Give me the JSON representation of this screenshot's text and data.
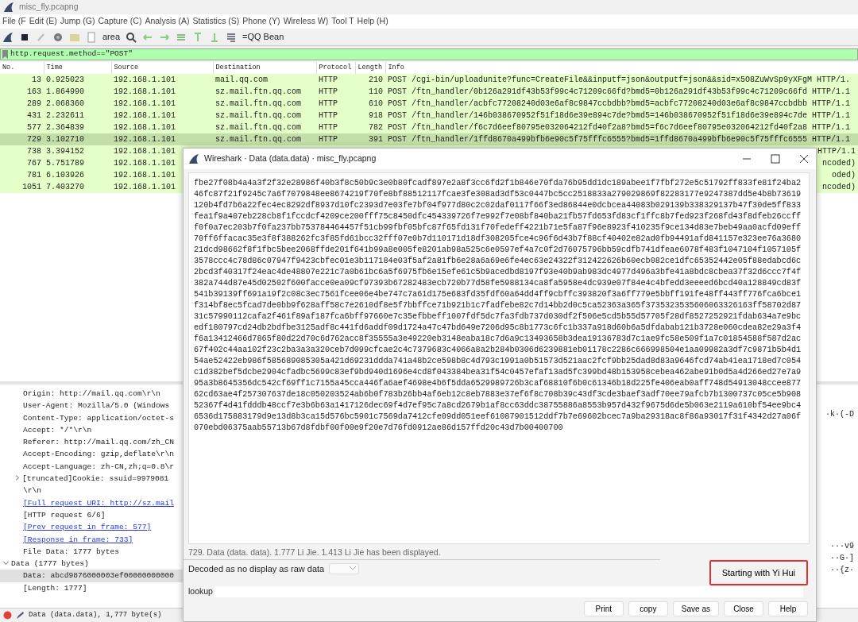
{
  "window": {
    "title": "misc_fly.pcapng"
  },
  "menu": [
    "File (F",
    "Edit (E)",
    "Jump (G)",
    "Capture (C)",
    "Analysis (A)",
    "Statistics (S)",
    "Phone (Y)",
    "Wireless W)",
    "Tool T",
    "Help (H)"
  ],
  "toolbar": {
    "labels": [
      "area",
      "=QQ Bean"
    ]
  },
  "filter": {
    "value": "http.request.method==\"POST\""
  },
  "packet_list": {
    "columns": [
      "No.",
      "Time",
      "Source",
      "Destination",
      "Protocol",
      "Length",
      "Info"
    ],
    "rows": [
      {
        "no": "13",
        "time": "0.925023",
        "source": "192.168.1.101",
        "destination": "mail.qq.com",
        "protocol": "HTTP",
        "length": "210",
        "info": "POST /cgi-bin/uploadunite?func=CreateFile&&inputf=json&outputf=json&&sid=x5O8ZuWvSp9yXFgM HTTP/1.",
        "selected": false
      },
      {
        "no": "163",
        "time": "1.864990",
        "source": "192.168.1.101",
        "destination": "sz.mail.ftn.qq.com",
        "protocol": "HTTP",
        "length": "110",
        "info": "POST /ftn_handler/0b126a291df43b53f99c4c71209c66fd?bmd5=0b126a291df43b53f99c4c71209c66fd HTTP/1.1",
        "selected": false
      },
      {
        "no": "289",
        "time": "2.068360",
        "source": "192.168.1.101",
        "destination": "sz.mail.ftn.qq.com",
        "protocol": "HTTP",
        "length": "610",
        "info": "POST /ftn_handler/acbfc77208240d03e6af8c9847ccbdbb?bmd5=acbfc77208240d03e6af8c9847ccbdbb HTTP/1.1",
        "selected": false
      },
      {
        "no": "431",
        "time": "2.232611",
        "source": "192.168.1.101",
        "destination": "sz.mail.ftn.qq.com",
        "protocol": "HTTP",
        "length": "918",
        "info": "POST /ftn_handler/146b038670952f51f18d6e39e894c7de?bmd5=146b038670952f51f18d6e39e894c7de HTTP/1.1",
        "selected": false
      },
      {
        "no": "577",
        "time": "2.364839",
        "source": "192.168.1.101",
        "destination": "sz.mail.ftn.qq.com",
        "protocol": "HTTP",
        "length": "782",
        "info": "POST /ftn_handler/f6c7d6eef80795e032064212fd40f2a8?bmd5=f6c7d6eef80795e032064212fd40f2a8 HTTP/1.1",
        "selected": false
      },
      {
        "no": "729",
        "time": "3.102710",
        "source": "192.168.1.101",
        "destination": "sz.mail.ftn.qq.com",
        "protocol": "HTTP",
        "length": "391",
        "info": "POST /ftn_handler/1ffd8670a499bfb6e90c5f75fffc6555?bmd5=1ffd8670a499bfb6e90c5f75fffc6555 HTTP/1.1",
        "selected": true
      },
      {
        "no": "738",
        "time": "3.394152",
        "source": "192.168.1.101",
        "info_tail": "HTTP/1.1",
        "selected": false
      },
      {
        "no": "767",
        "time": "5.751789",
        "source": "192.168.1.101",
        "info_tail": "ncoded)",
        "selected": false
      },
      {
        "no": "781",
        "time": "6.103926",
        "source": "192.168.1.101",
        "info_tail": "oded)",
        "selected": false
      },
      {
        "no": "1051",
        "time": "7.403270",
        "source": "192.168.1.101",
        "info_tail": "ncoded)",
        "selected": false
      }
    ]
  },
  "details": {
    "http_items": [
      {
        "text": "Origin: http://mail.qq.com\\r\\n",
        "kind": "field",
        "selected": false
      },
      {
        "text": "User-Agent: Mozilla/5.0 (Windows",
        "kind": "field",
        "selected": false
      },
      {
        "text": "Content-Type: application/octet-s",
        "kind": "field",
        "selected": false
      },
      {
        "text": "Accept: */*\\r\\n",
        "kind": "field",
        "selected": false
      },
      {
        "text": "Referer: http://mail.qq.com/zh_CN",
        "kind": "field",
        "selected": false
      },
      {
        "text": "Accept-Encoding: gzip,deflate\\r\\n",
        "kind": "field",
        "selected": false
      },
      {
        "text": "Accept-Language: zh-CN,zh;q=0.8\\r",
        "kind": "field",
        "selected": false
      },
      {
        "text": "[truncated]Cookie: ssuid=9979081",
        "kind": "field",
        "expanded": false,
        "selected": false
      },
      {
        "text": "\\r\\n",
        "kind": "field",
        "selected": false
      },
      {
        "text": "[Full request URI: http://sz.mail",
        "kind": "link",
        "selected": false
      },
      {
        "text": "[HTTP request 6/6]",
        "kind": "field",
        "selected": false
      },
      {
        "text": "[Prev request in frame: 577]",
        "kind": "link",
        "selected": false
      },
      {
        "text": "[Response in frame: 733]",
        "kind": "link",
        "selected": false
      },
      {
        "text": "File Data: 1777 bytes",
        "kind": "field",
        "selected": false
      }
    ],
    "data_tree": [
      {
        "text": "Data (1777 bytes)",
        "expanded": true,
        "selected": false,
        "children": [
          {
            "text": "Data: abcd9876000003ef00000000000",
            "selected": true
          },
          {
            "text": "[Length: 1777]",
            "selected": false
          }
        ]
      }
    ]
  },
  "bytes_pane": {
    "upper": [
      "·k·(-D"
    ],
    "lower": [
      "···v9",
      "··G·]",
      "··{z·"
    ]
  },
  "status_bar": {
    "text": "Data (data.data), 1,777 byte(s)"
  },
  "dialog": {
    "title": "Wireshark · Data (data.data) · misc_fly.pcapng",
    "content_lines": [
      "fbe27f08b4a4a3f2f32e28986f40b3f8c50b9c3e0b80fcadf897e2a8f3cc6fd2f1b846e70fda76b95dd1dc189abee1f7fbf272e5c51792ff833fe81f24ba2",
      "46fc87f21f9245c7a6f7079848ee8674219f70fe8bf88512117fcae3fe308ad3df53c0447bc5cc2518833a279029869f82283177e9247387dd5e4b8b73619",
      "120b4fd7b6a22fec4ec8292df8937d10fc2393d7e03fe7bf04f977d80c2c02daf0117f66f3ed86844e0dcbcea44083b029139b338329137b47f30de5ff833",
      "fea1f9a407eb228cb8f1fccdcf4209ce200fff75c8450dfc454339726f7e992f7e08bf840ba21fb57fd653fd83cf1ffc8b7fed923f268fd43f8dfeb26ccff",
      "f0f0a7ec203b7f0fa237bb753784464457f51cb99fbf05bfc87f65fd131f70fedeff4221b71e5fa87f96e8923f410235f9ce134d83e7beb49aa0acfd09eff",
      "70ff6ffacac35e3f8f388262fc3f85fd61bcc32fff07e0b7d110171d18df308205fce4c96f6d43b7f88cf40402e82ad0fb94491afd841157e323ee76a3680",
      "21dcd98662f8f1fbc5bee2068ffde201f641b99a8e005fe8201ab98a525c6e0597ef4a7c0f2d76075796bb59cdfb741dfeae6078f483f1047104f1057105f",
      "3578ccc4c78d86c07947f9423cbfec01e3b117184e03f5af2a81fb6e28a6a69e6fe4ec63e24322f312422626b60ecb082ce1dfc65352442e05f88edabcd6c",
      "2bcd3f40317f24eac4de48807e221c7a0b61bc6a5f6975fb6e15efe61c5b9acedbd8197f93e40b9ab983dc4977d496a3bfe41a8bdc8cbea37f32d6ccc7f4f",
      "382a744d87e45d02502f600facce0ea09cf97393b67282483ecb720b77d58fe5988134ca8fa5958e4dc939e07f84e4c4bfedd3eeeed6bcd40a128849cd83f",
      "541b39139ff691a19f2c08c3ec7561fcee06e4be747c7a61d175e683fd35fdf60a64dd4ff9cbffc393820f3a6ff779e5bbff191fe48ff443ff776fca6bce1",
      "f314bf8ec5fcad7de0bb9f628aff58c7e2610df8e5f7bbffce71b921b1c7fadfebe82c7d14bb2d0c5ca52363a365f3735323535606063326163ff58702d87",
      "31c57990112cafa2f461f89af187fca6bff97660e7c35efbbeff1007fdf5dc7fa3fdb737d030df2f506e5cd5b55d57705f28df8527252921fdab634a7e9bc",
      "edf180797cd24db2bdfbe3125adf8c441fd6addf09d1724a47c47bd649e7206d95c8b1773c6fc1b337a918d60b6a5dfdabab121b3728e060cdea82e29a3f4",
      "f6a13412466d7865f80d22d70c6d762acc8f35555a3e49220eb3148eaba18c7d6a9c13493658b3dea19136783d7c1ae9fc58e509f1a7c01854588f587d2ac",
      "67f402c44aa102f23c2ba3a3a320ceb7d099cfcae2c4c7379683c4066a8a2b284b0306d6239881eb01178c2286c666998504e1aa09982a3df7c9871b5b4d1",
      "54ae52422eb986f585689085305a421d69231ddda741a48b2ce598b8c4d793c1991a0b51573d521aac2fcf9bb25dad8d83a9646fcd74ab41ea1718ed7c054",
      "c1d382bef5dcbe2904cfadbc5699c83ef9bd940d1696e4cd8f043384bea31f54c0457efaf13ad5fc399bd48b153958cebea462abe91b0d5a4d266ed27e7a9",
      "95a3b8645356dc542cf69ff1c7155a45cca446fa6aef4698e4b6f5dda6529989726b3caf68810f6b0c61346b18d225fe406eab0aff748d54913048ccee877",
      "62cd63ae4f257307637de18c050203524ab6b0f783b26bb4af6eb12c8eb7883e37ef6f8c708b39c43df3cde3baef3adf70ee79afcb7b1300737c05ce5b908",
      "52367f4d41fdddb48ccf7e3b6b63a1417126dec69f4d7ef95c7a8cd2679b1af8cc63ddc38755886a8553b957d432f9675d6de5b063e2119a610bf54ee9bc4",
      "6536d175883179d9e13d8b3ca15d576bc5901c7569da7412cfe09dd051eef61087901512ddf7b7e69602bcec7a9ba29318ac8f86a93017f31f4342d27a06f",
      "070ebd06375aab55713b67d8fdbf00f00e9f20e7d76fd0912ae86d157ffd20c43d7b00400700"
    ],
    "status": "729. Data (data. data). 1.777 Li Jie. 1.413 Li Jie has been displayed.",
    "decode_label": "Decoded as no display as raw data",
    "find_button": {
      "label": "Starting with Yi Hui",
      "highlighted": true
    },
    "find_label": "lookup",
    "buttons": [
      "Print",
      "copy",
      "Save as",
      "Close",
      "Help"
    ]
  }
}
